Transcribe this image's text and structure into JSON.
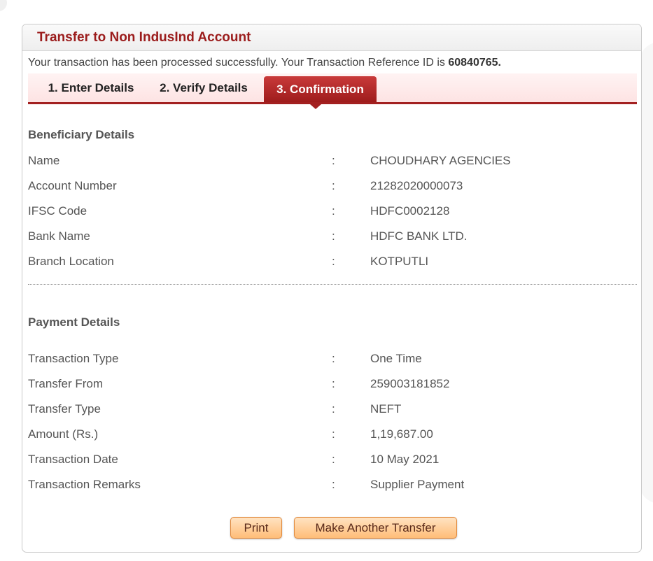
{
  "panel": {
    "title": "Transfer to Non IndusInd Account"
  },
  "message": {
    "text": "Your transaction has been processed successfully. Your Transaction Reference ID is ",
    "reference_id": "60840765."
  },
  "steps": [
    {
      "label": "1. Enter Details",
      "active": false
    },
    {
      "label": "2. Verify Details",
      "active": false
    },
    {
      "label": "3. Confirmation",
      "active": true
    }
  ],
  "beneficiary": {
    "title": "Beneficiary Details",
    "separator": ":",
    "rows": [
      {
        "label": "Name",
        "value": "CHOUDHARY AGENCIES"
      },
      {
        "label": "Account Number",
        "value": "21282020000073"
      },
      {
        "label": "IFSC Code",
        "value": "HDFC0002128"
      },
      {
        "label": "Bank Name",
        "value": "HDFC BANK LTD."
      },
      {
        "label": "Branch Location",
        "value": "KOTPUTLI"
      }
    ]
  },
  "payment": {
    "title": "Payment Details",
    "separator": ":",
    "rows": [
      {
        "label": "Transaction Type",
        "value": "One Time"
      },
      {
        "label": "Transfer From",
        "value": "259003181852"
      },
      {
        "label": "Transfer Type",
        "value": "NEFT"
      },
      {
        "label": "Amount (Rs.)",
        "value": "1,19,687.00"
      },
      {
        "label": "Transaction Date",
        "value": "10 May 2021"
      },
      {
        "label": "Transaction Remarks",
        "value": "Supplier Payment"
      }
    ]
  },
  "buttons": {
    "print": "Print",
    "make_another": "Make Another Transfer"
  },
  "colors": {
    "accent": "#9b1c1c",
    "tab_active": "#a32020",
    "button": "#ffbd78"
  }
}
